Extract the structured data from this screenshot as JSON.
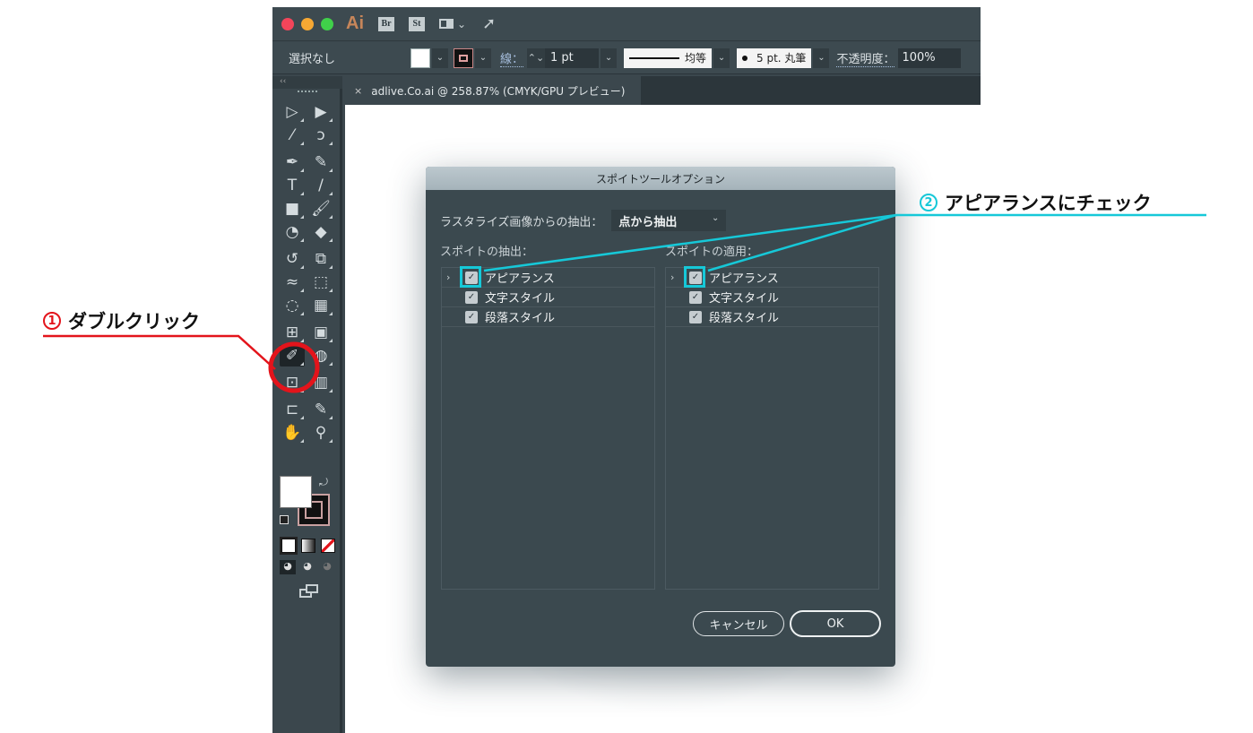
{
  "titlebar": {
    "app_logo": "Ai",
    "bridge_badge": "Br",
    "stock_badge": "St",
    "layout_chevron": "⌄",
    "rocket_icon": "🚀"
  },
  "controlbar": {
    "selection": "選択なし",
    "stroke_label": "線：",
    "stroke_width": "1 pt",
    "profile_label": "均等",
    "brush_label": "5 pt. 丸筆",
    "opacity_label": "不透明度：",
    "opacity_value": "100%",
    "dropdown_glyph": "⌄",
    "stepper_glyph": "⌃⌄"
  },
  "tool_panel": {
    "collapse_glyph": "‹‹",
    "tools": [
      {
        "name": "selection-tool",
        "glyph": "▷"
      },
      {
        "name": "direct-selection-tool",
        "glyph": "▶"
      },
      {
        "name": "magic-wand-tool",
        "glyph": "⁄"
      },
      {
        "name": "lasso-tool",
        "glyph": "ↄ"
      },
      {
        "name": "pen-tool",
        "glyph": "✒"
      },
      {
        "name": "curvature-tool",
        "glyph": "✎"
      },
      {
        "name": "type-tool",
        "glyph": "T"
      },
      {
        "name": "line-tool",
        "glyph": "/"
      },
      {
        "name": "rectangle-tool",
        "glyph": "■"
      },
      {
        "name": "paintbrush-tool",
        "glyph": "🖌"
      },
      {
        "name": "shaper-tool",
        "glyph": "◔"
      },
      {
        "name": "eraser-tool",
        "glyph": "◆"
      },
      {
        "name": "rotate-tool",
        "glyph": "↺"
      },
      {
        "name": "scale-tool",
        "glyph": "⧉"
      },
      {
        "name": "warp-tool",
        "glyph": "≈"
      },
      {
        "name": "free-transform-tool",
        "glyph": "⬚"
      },
      {
        "name": "shape-builder-tool",
        "glyph": "◌"
      },
      {
        "name": "perspective-grid-tool",
        "glyph": "▦"
      },
      {
        "name": "mesh-tool",
        "glyph": "⊞"
      },
      {
        "name": "gradient-tool",
        "glyph": "▣"
      },
      {
        "name": "eyedropper-tool",
        "glyph": "✐"
      },
      {
        "name": "blend-tool",
        "glyph": "◍"
      },
      {
        "name": "symbol-sprayer-tool",
        "glyph": "⊡"
      },
      {
        "name": "column-graph-tool",
        "glyph": "▥"
      },
      {
        "name": "artboard-tool",
        "glyph": "⊏"
      },
      {
        "name": "slice-tool",
        "glyph": "✎"
      },
      {
        "name": "hand-tool",
        "glyph": "✋"
      },
      {
        "name": "zoom-tool",
        "glyph": "⚲"
      }
    ],
    "swap_glyph": "⤾"
  },
  "document": {
    "tab_close": "×",
    "tab_title": "adlive.Co.ai @ 258.87% (CMYK/GPU プレビュー)"
  },
  "dialog": {
    "title": "スポイトツールオプション",
    "raster_label": "ラスタライズ画像からの抽出：",
    "raster_value": "点から抽出",
    "raster_chevron": "⌄",
    "pick_up_label": "スポイトの抽出：",
    "apply_label": "スポイトの適用：",
    "pick_up_items": [
      {
        "label": "アピアランス",
        "checked": true,
        "expandable": true
      },
      {
        "label": "文字スタイル",
        "checked": true,
        "expandable": false
      },
      {
        "label": "段落スタイル",
        "checked": true,
        "expandable": false
      }
    ],
    "apply_items": [
      {
        "label": "アピアランス",
        "checked": true,
        "expandable": true
      },
      {
        "label": "文字スタイル",
        "checked": true,
        "expandable": false
      },
      {
        "label": "段落スタイル",
        "checked": true,
        "expandable": false
      }
    ],
    "expander_glyph": "›",
    "check_glyph": "✓",
    "cancel_label": "キャンセル",
    "ok_label": "OK"
  },
  "annotations": {
    "step1_number": "1",
    "step1_text": "ダブルクリック",
    "step1_color": "#e3141b",
    "step2_number": "2",
    "step2_text": "アピアランスにチェック",
    "step2_color": "#16c8d8"
  }
}
